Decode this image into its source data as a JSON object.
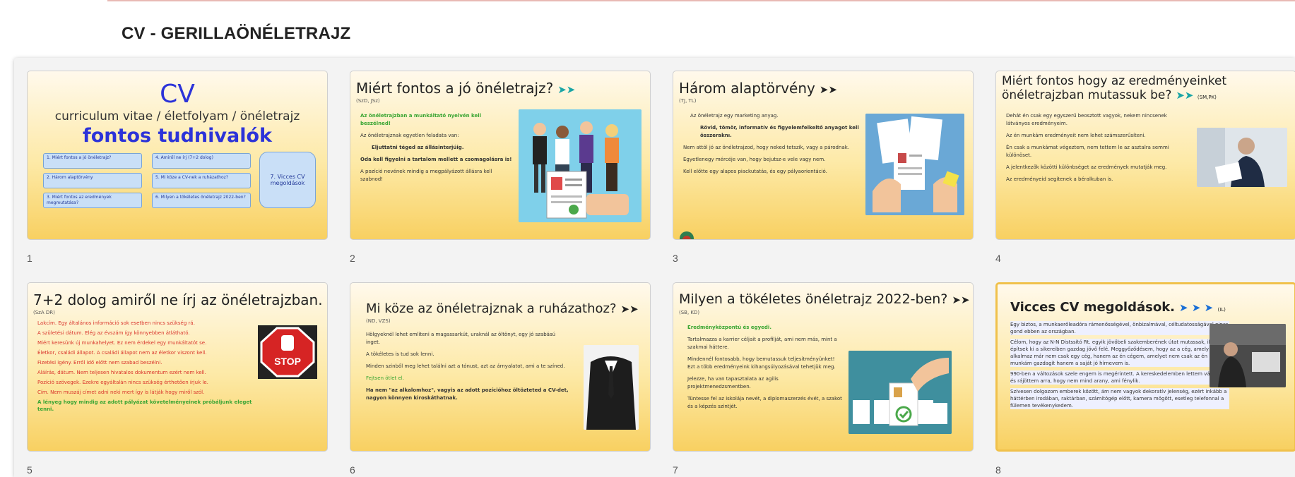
{
  "doc_title": "CV - GERILLAÖNÉLETRAJZ",
  "slides": [
    {
      "num": "1",
      "title": "CV",
      "subtitle": "curriculum vitae / életfolyam / önéletrajz",
      "headline": "fontos tudnivalók",
      "toc": [
        "1. Miért fontos a jó önéletrajz?",
        "2. Három alaptörvény",
        "3. Miért fontos az eredmények megmutatása?",
        "4. Amiről ne írj (7+2 dolog)",
        "5. Mi köze a CV-nek a ruházathoz?",
        "6. Milyen a tökéletes önéletrajz 2022-ben?"
      ],
      "toc_big": "7. Vicces CV megoldások"
    },
    {
      "num": "2",
      "title": "Miért fontos a jó önéletrajz?",
      "arrow": "➤➤",
      "sub": "(SzD, JSz)",
      "body": [
        "Az önéletrajzban a munkáltató nyelvén kell beszélned!",
        "Az önéletrajznak egyetlen feladata van:",
        "Eljuttatni téged az állásinterjúig.",
        "Oda kell figyelni a tartalom mellett a csomagolásra is!",
        "A pozíció nevének mindig a megpályázott állásra kell szabnod!"
      ]
    },
    {
      "num": "3",
      "title": "Három alaptörvény",
      "arrow": "➤➤",
      "sub": "(TJ, TL)",
      "body": [
        "Az önéletrajz egy marketing anyag.",
        "Rövid, tömör, informatív és figyelemfelkeltő anyagot kell összeraknı.",
        "Nem attól jó az önéletrajzod, hogy neked tetszik, vagy a párodnak.",
        "Egyetlenegy mércéje van, hogy bejutsz-e vele vagy nem.",
        "Kell előtte egy alapos piackutatás, és egy pályaorientáció."
      ]
    },
    {
      "num": "4",
      "title": "Miért fontos hogy az eredményeinket önéletrajzban mutassuk be?",
      "arrow": "➤➤",
      "sub": "(SM,PK)",
      "body": [
        "Dehát én csak egy egyszerű beosztott vagyok, nekem nincsenek látványos eredményeim.",
        "Az én munkám eredményeit nem lehet számszerűsíteni.",
        "Én csak a munkámat végeztem, nem tettem le az asztalra semmi különöset.",
        "A jelentkezők közötti különbséget az eredmények mutatják meg.",
        "Az eredményeid segítenek a béralkuban is."
      ]
    },
    {
      "num": "5",
      "title": "7+2 dolog amiről ne írj az önéletrajzban.",
      "arrow": "➤➤",
      "sub": "(SzA DR)",
      "body": [
        "Lakcím. Egy általános információ sok esetben nincs szükség rá.",
        "A születési dátum. Elég az évszám így könnyebben átlátható.",
        "Miért keresünk új munkahelyet. Ez nem érdekel egy munkáltatót se.",
        "Életkor, családi állapot. A családi állapot nem az életkor viszont kell.",
        "Fizetési igény. Erről idő előtt nem szabad beszélni.",
        "Aláírás, dátum. Nem teljesen hivatalos dokumentum ezért nem kell.",
        "Pozíció szövegek. Ezekre egyáltalán nincs szükség érthetően írjuk le.",
        "Cím. Nem muszáj címet adni neki mert így is látják hogy miről szól.",
        "A lényeg hogy mindig az adott pályázat követelményeinek próbáljunk eleget tenni."
      ],
      "stop": "STOP"
    },
    {
      "num": "6",
      "title": "Mi köze az önéletrajznak a ruházathoz?",
      "arrow": "➤➤",
      "sub": "(ND, VZS)",
      "body": [
        "Hölgyeknél lehet említeni a magassarkút, uraknál az öltönyt, egy jó szabású inget.",
        "A tökéletes is tud sok lenni.",
        "Minden szinből meg lehet találni azt a tónust, azt az árnyalatot, ami a te színed.",
        "Fejtsen ötlet el.",
        "Ha nem \"az alkalomhoz\", vagyis az adott pozícióhoz öltözteted a CV-det, nagyon könnyen kiroskáthatnak."
      ]
    },
    {
      "num": "7",
      "title": "Milyen a tökéletes önéletrajz 2022-ben?",
      "arrow": "➤➤",
      "sub": "(SB, KD)",
      "body": [
        "Eredményközpontú és egyedi.",
        "Tartalmazza a karrier céljait a profilját, ami nem más, mint a szakmai háttere.",
        "Mindennél fontosabb, hogy bemutassuk teljesítményünket! Ezt a több eredményeink kihangsúlyozásával tehetjük meg.",
        "Jelezze, ha van tapasztalata az agilis projektmenedzsmentben.",
        "Tüntesse fel az iskolája nevét, a diplomaszerzés évét, a szakot és a képzés szintjét."
      ]
    },
    {
      "num": "8",
      "title": "Vicces CV megoldások.",
      "arrow": "➤ ➤ ➤",
      "sub": "(IL)",
      "body": [
        "Egy biztos, a munkaerőleadóra rámenősségével, önbizalmával, céltudatosságával nincs gond ebben az országban.",
        "Célom, hogy az N-N Distssító Rt. egyik jövőbeli szakemberének útat mutassak, illetve építsek ki a sikereiben gazdag jövő felé. Meggyőződésem, hogy az a cég, amely alkalmaz már nem csak egy cég, hanem az én cégem, amelyet nem csak az én munkám gazdagít hanem a saját jó hírnevem is.",
        "990-ben a változások szele engem is megérintett. A kereskedelemben lettem vállalkozó és rájöttem arra, hogy nem mind arany, ami fénylik.",
        "Szívesen dolgozom emberek között, ám nem vagyok dekoratív jelenség, ezért inkább a háttérben irodában, raktárban, számítógép előtt, kamera mögött, esetleg telefonnal a fülemen tevékenykedem."
      ]
    }
  ]
}
